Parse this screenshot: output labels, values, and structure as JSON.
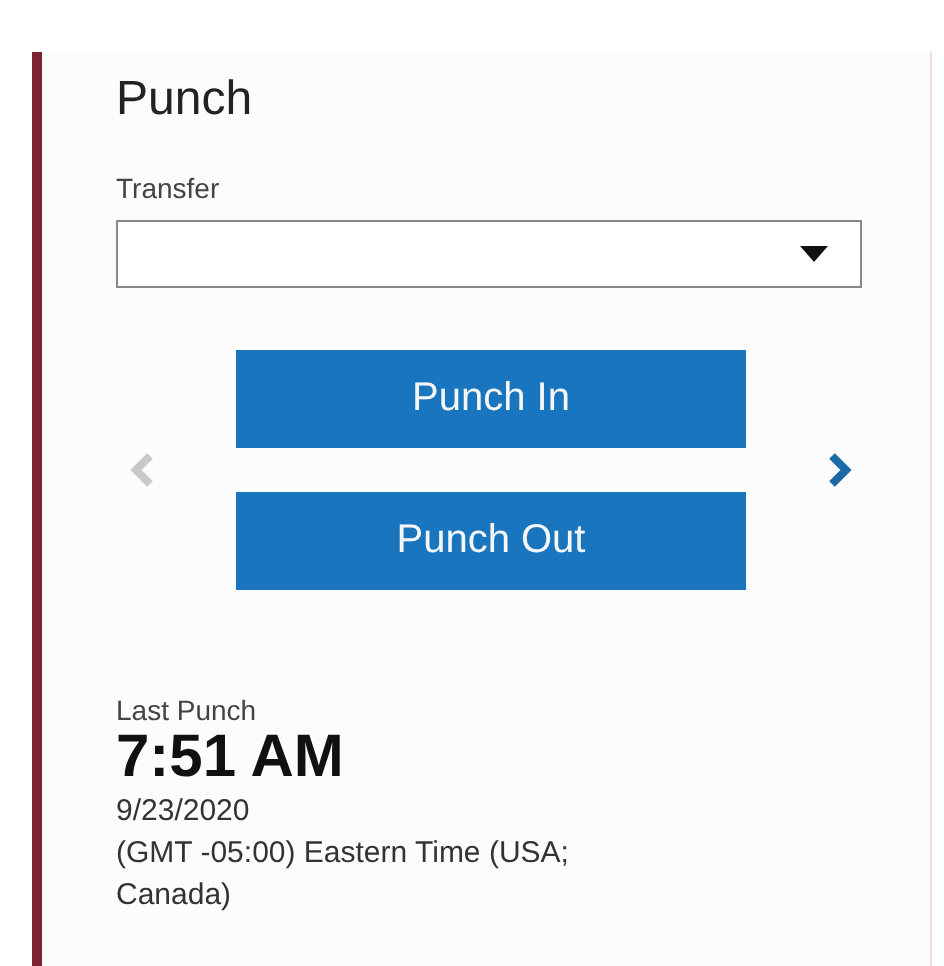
{
  "title": "Punch",
  "transfer": {
    "label": "Transfer"
  },
  "carousel": {
    "prev_disabled": true,
    "next_disabled": false
  },
  "buttons": [
    {
      "label": "Punch In"
    },
    {
      "label": "Punch Out"
    }
  ],
  "last_punch": {
    "label": "Last Punch",
    "time": "7:51 AM",
    "date": "9/23/2020",
    "timezone": "(GMT -05:00) Eastern Time (USA; Canada)"
  }
}
